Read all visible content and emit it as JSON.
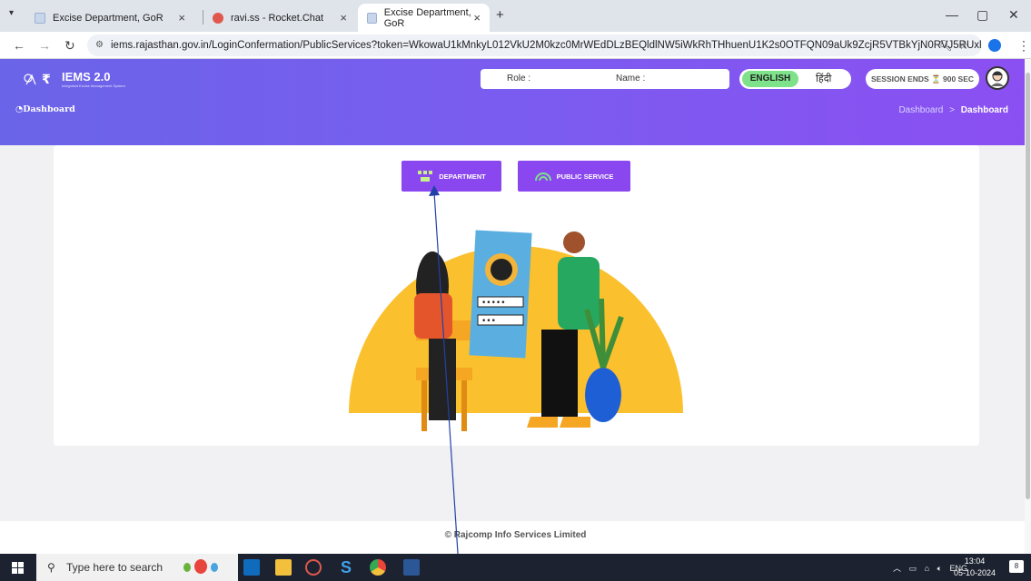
{
  "browser": {
    "tabs": [
      {
        "label": "Excise Department, GoR",
        "active": false
      },
      {
        "label": "ravi.ss - Rocket.Chat",
        "active": false
      },
      {
        "label": "Excise Department, GoR",
        "active": true
      }
    ],
    "url": "iems.rajasthan.gov.in/LoginConfermation/PublicServices?token=WkowaU1kMnkyL012VkU2M0kzc0MrWEdDLzBEQldlNW5iWkRhTHhuenU1K2s0OTFQN09aUk9ZcjR5VTBkYjN0RVJ5RUxlZnFvL3U0Vz..."
  },
  "header": {
    "logo_text": "IEMS 2.0",
    "logo_subtitle": "Integrated Excise Management System",
    "role_label": "Role :",
    "name_label": "Name :",
    "lang_english": "ENGLISH",
    "lang_hindi": "हिंदी",
    "session_label": "SESSION ENDS ⏳ 900 SEC",
    "page_label": "Dashboard",
    "breadcrumb_parent": "Dashboard",
    "breadcrumb_sep": ">",
    "breadcrumb_current": "Dashboard"
  },
  "main": {
    "department_button": "DEPARTMENT",
    "public_service_button": "PUBLIC SERVICE"
  },
  "footer": {
    "copyright": "© Rajcomp Info Services Limited"
  },
  "taskbar": {
    "search_placeholder": "Type here to search",
    "lang": "ENG",
    "time": "13:04",
    "date": "05-10-2024",
    "notification_count": "8"
  },
  "colors": {
    "header_gradient_start": "#6a64e8",
    "header_gradient_end": "#8b4ff2",
    "button": "#8a47ef",
    "english_active": "#7ee28a"
  }
}
